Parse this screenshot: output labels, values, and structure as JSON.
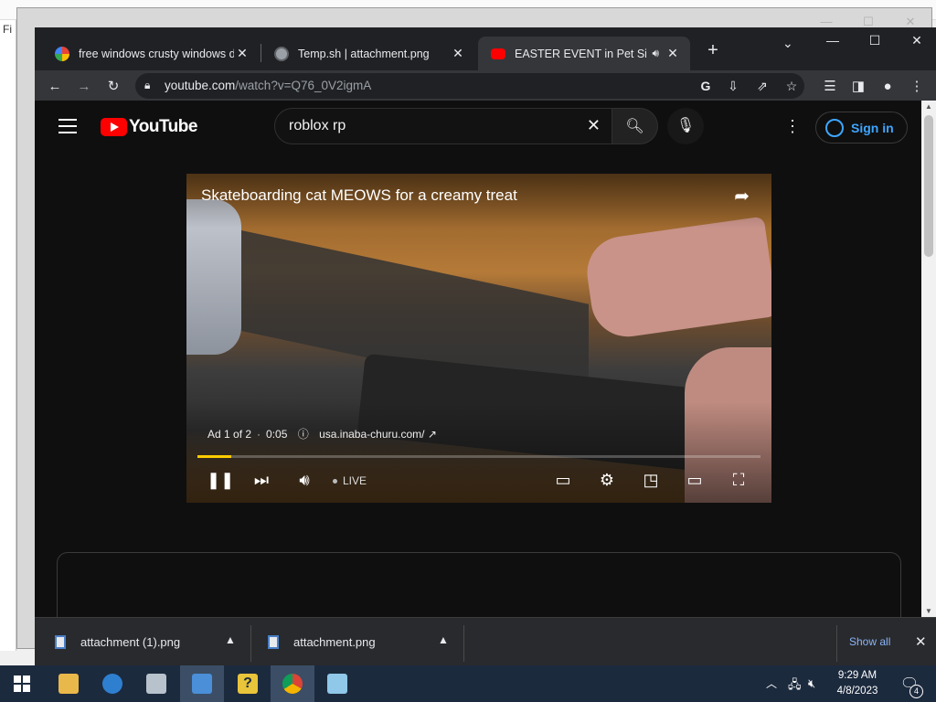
{
  "browser": {
    "tabs": [
      {
        "title": "free windows crusty windows do",
        "close": "✕",
        "active": false
      },
      {
        "title": "Temp.sh | attachment.png",
        "close": "✕",
        "active": false
      },
      {
        "title": "EASTER EVENT in Pet Simula",
        "close": "✕",
        "active": true
      }
    ],
    "new_tab": "+",
    "url_host": "youtube.com",
    "url_path": "/watch?v=Q76_0V2igmA"
  },
  "youtube": {
    "logo_text": "YouTube",
    "search_value": "roblox rp",
    "signin_label": "Sign in"
  },
  "player": {
    "video_title": "Skateboarding cat MEOWS for a creamy treat",
    "ad_label": "Ad 1 of 2",
    "ad_time": "0:05",
    "ad_url": "usa.inaba-churu.com/",
    "live_label": "LIVE",
    "progress_fraction": 0.06
  },
  "downloads": {
    "items": [
      {
        "name": "attachment (1).png"
      },
      {
        "name": "attachment.png"
      }
    ],
    "show_all": "Show all"
  },
  "taskbar": {
    "time": "9:29 AM",
    "date": "4/8/2023",
    "notification_count": "4"
  },
  "colors": {
    "youtube_red": "#ff0000",
    "signin_blue": "#3ea6ff",
    "progress_yellow": "#ffcc00",
    "chrome_dark": "#202124"
  }
}
